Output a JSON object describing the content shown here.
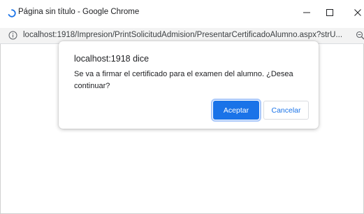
{
  "window": {
    "title": "Página sin título - Google Chrome",
    "icons": {
      "tab": "loading-spinner-icon",
      "minimize": "minimize-icon",
      "maximize": "maximize-icon",
      "close": "close-icon"
    }
  },
  "addressbar": {
    "url": "localhost:1918/Impresion/PrintSolicitudAdmision/PresentarCertificadoAlumno.aspx?strU...",
    "icons": {
      "site_info": "info-icon",
      "zoom": "zoom-icon"
    }
  },
  "dialog": {
    "title": "localhost:1918 dice",
    "message": "Se va a firmar el certificado para el examen del alumno. ¿Desea continuar?",
    "ok_label": "Aceptar",
    "cancel_label": "Cancelar"
  },
  "colors": {
    "accent": "#1a73e8",
    "spinner": "#1a73e8",
    "focus_ring": "#a8c7fa"
  }
}
